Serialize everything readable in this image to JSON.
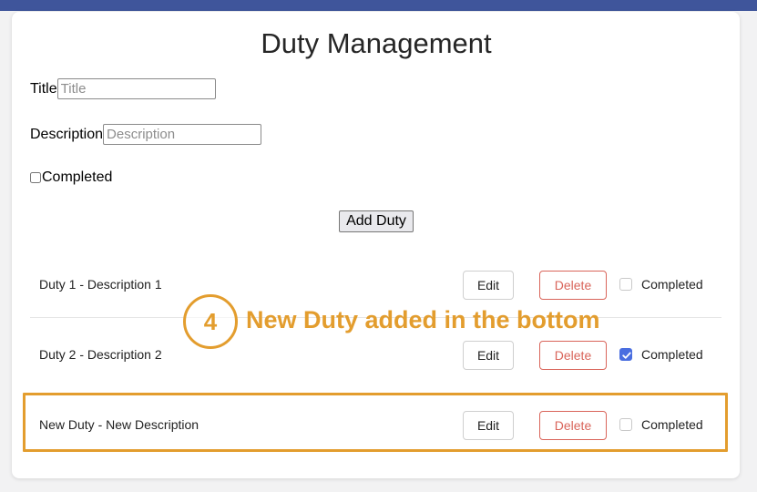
{
  "app": {
    "title": "Duty Management"
  },
  "form": {
    "title_label": "Title",
    "title_placeholder": "Title",
    "description_label": "Description",
    "description_placeholder": "Description",
    "completed_label": "Completed",
    "completed_checked": false,
    "add_button": "Add Duty"
  },
  "duties": [
    {
      "text": "Duty 1 - Description 1",
      "edit": "Edit",
      "delete": "Delete",
      "completed_label": "Completed",
      "completed": false
    },
    {
      "text": "Duty 2 - Description 2",
      "edit": "Edit",
      "delete": "Delete",
      "completed_label": "Completed",
      "completed": true
    },
    {
      "text": "New Duty - New Description",
      "edit": "Edit",
      "delete": "Delete",
      "completed_label": "Completed",
      "completed": false
    }
  ],
  "annotation": {
    "step_number": "4",
    "text": "New Duty added in the bottom",
    "color": "#e39d2e"
  },
  "colors": {
    "topbar": "#3f559b",
    "delete": "#d9645a",
    "checkbox_checked": "#4a6ee0"
  }
}
